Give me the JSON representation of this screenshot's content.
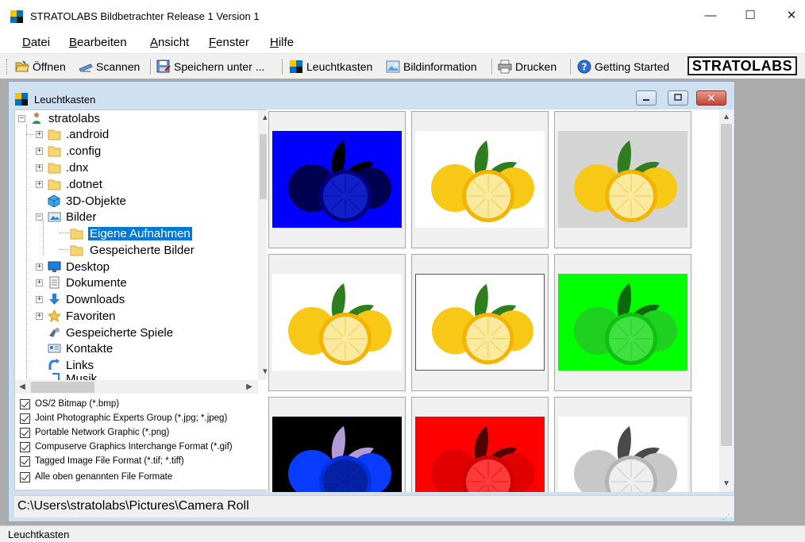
{
  "window": {
    "title": "STRATOLABS Bildbetrachter Release 1 Version 1"
  },
  "window_controls": {
    "minimize": "—",
    "maximize": "☐",
    "close": "✕"
  },
  "menu": [
    {
      "label": "Datei"
    },
    {
      "label": "Bearbeiten"
    },
    {
      "label": "Ansicht"
    },
    {
      "label": "Fenster"
    },
    {
      "label": "Hilfe"
    }
  ],
  "toolbar": {
    "open": {
      "label": "Öffnen",
      "icon": "folder-open-icon"
    },
    "scan": {
      "label": "Scannen",
      "icon": "scanner-icon"
    },
    "save_as": {
      "label": "Speichern unter ...",
      "icon": "save-as-icon"
    },
    "lightbox": {
      "label": "Leuchtkasten",
      "icon": "lightbox-icon"
    },
    "info": {
      "label": "Bildinformation",
      "icon": "image-info-icon"
    },
    "print": {
      "label": "Drucken",
      "icon": "printer-icon"
    },
    "help": {
      "label": "Getting Started",
      "icon": "help-icon"
    },
    "brand": "STRATOLABS"
  },
  "child_window": {
    "title": "Leuchtkasten",
    "close_glyph": "✕"
  },
  "tree": {
    "items": [
      {
        "label": "stratolabs",
        "icon": "user-icon"
      },
      {
        "label": ".android",
        "icon": "folder-icon"
      },
      {
        "label": ".config",
        "icon": "folder-icon"
      },
      {
        "label": ".dnx",
        "icon": "folder-icon"
      },
      {
        "label": ".dotnet",
        "icon": "folder-icon"
      },
      {
        "label": "3D-Objekte",
        "icon": "cube-icon"
      },
      {
        "label": "Bilder",
        "icon": "pictures-icon"
      },
      {
        "label": "Eigene Aufnahmen",
        "icon": "folder-icon",
        "selected": true
      },
      {
        "label": "Gespeicherte Bilder",
        "icon": "folder-icon"
      },
      {
        "label": "Desktop",
        "icon": "desktop-icon"
      },
      {
        "label": "Dokumente",
        "icon": "documents-icon"
      },
      {
        "label": "Downloads",
        "icon": "download-icon"
      },
      {
        "label": "Favoriten",
        "icon": "star-icon"
      },
      {
        "label": "Gespeicherte Spiele",
        "icon": "games-icon"
      },
      {
        "label": "Kontakte",
        "icon": "contacts-icon"
      },
      {
        "label": "Links",
        "icon": "link-icon"
      },
      {
        "label": "Musik",
        "icon": "music-icon"
      }
    ]
  },
  "formats": [
    {
      "label": "OS/2 Bitmap (*.bmp)",
      "checked": true
    },
    {
      "label": "Joint Photographic Experts Group (*.jpg; *.jpeg)",
      "checked": true
    },
    {
      "label": "Portable Network Graphic (*.png)",
      "checked": true
    },
    {
      "label": "Compuserve Graphics Interchange Format (*.gif)",
      "checked": true
    },
    {
      "label": "Tagged Image File Format (*.tif; *.tiff)",
      "checked": true
    },
    {
      "label": "Alle oben genannten File Formate",
      "checked": true
    }
  ],
  "path": "C:\\Users\\stratolabs\\Pictures\\Camera Roll",
  "thumbnails": [
    {
      "variant": "blue",
      "bg": "#0000ff"
    },
    {
      "variant": "original",
      "bg": "#ffffff"
    },
    {
      "variant": "gray-background",
      "bg": "#d4d4d4"
    },
    {
      "variant": "original",
      "bg": "#ffffff"
    },
    {
      "variant": "original-framed",
      "bg": "#ffffff"
    },
    {
      "variant": "green",
      "bg": "#00ff00"
    },
    {
      "variant": "inverted-blue",
      "bg": "#000000"
    },
    {
      "variant": "red",
      "bg": "#ff0000"
    },
    {
      "variant": "grayscale",
      "bg": "#ffffff"
    }
  ],
  "status": "Leuchtkasten",
  "colors": {
    "accent": "#0078d7",
    "mdi_background": "#ababab",
    "child_frame": "#cfe0f1"
  }
}
